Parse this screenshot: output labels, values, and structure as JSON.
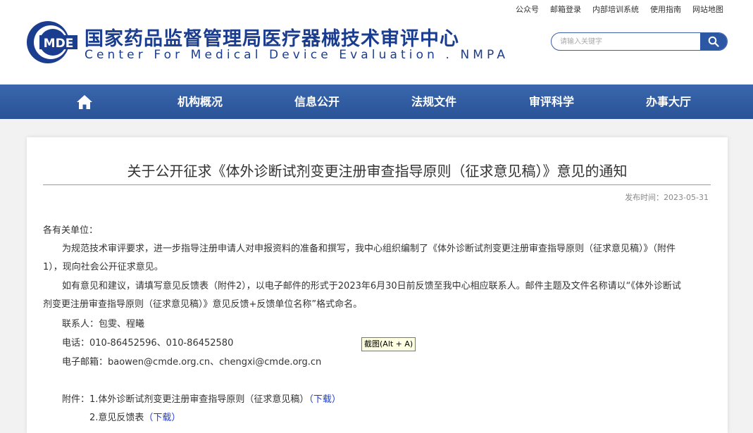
{
  "top_links": [
    "公众号",
    "邮箱登录",
    "内部培训系统",
    "使用指南",
    "网站地图"
  ],
  "logo": {
    "text": "MDE"
  },
  "site": {
    "name_cn": "国家药品监督管理局医疗器械技术审评中心",
    "name_en": "Center For Medical Device Evaluation . NMPA"
  },
  "search": {
    "placeholder": "请输入关键字",
    "icon": "search-icon"
  },
  "nav": {
    "home_icon": "home-icon",
    "items": [
      "机构概况",
      "信息公开",
      "法规文件",
      "审评科学",
      "办事大厅"
    ]
  },
  "article": {
    "title": "关于公开征求《体外诊断试剂变更注册审查指导原则（征求意见稿）》意见的通知",
    "pub_label": "发布时间：",
    "pub_date": "2023-05-31",
    "salutation": "各有关单位：",
    "p1_line1": "为规范技术审评要求，进一步指导注册申请人对申报资料的准备和撰写，我中心组织编制了《体外诊断试剂变更注册审查指导原则（征求意见稿）》（附件",
    "p1_line2": "1），现向社会公开征求意见。",
    "p2_line1": "如有意见和建议，请填写意见反馈表（附件2），以电子邮件的形式于2023年6月30日前反馈至我中心相应联系人。邮件主题及文件名称请以“《体外诊断试",
    "p2_line2": "剂变更注册审查指导原则（征求意见稿）》意见反馈+反馈单位名称”格式命名。",
    "contact": "联系人：包雯、程曦",
    "phone": "电话：010-86452596、010-86452580",
    "email": "电子邮箱：baowen@cmde.org.cn、chengxi@cmde.org.cn",
    "attachments_label": "附件：",
    "attachments": [
      {
        "name": "1.体外诊断试剂变更注册审查指导原则（征求意见稿）",
        "link": "（下载）"
      },
      {
        "name": "2.意见反馈表",
        "link": "（下载）"
      }
    ]
  },
  "tooltip": "截图(Alt + A)"
}
